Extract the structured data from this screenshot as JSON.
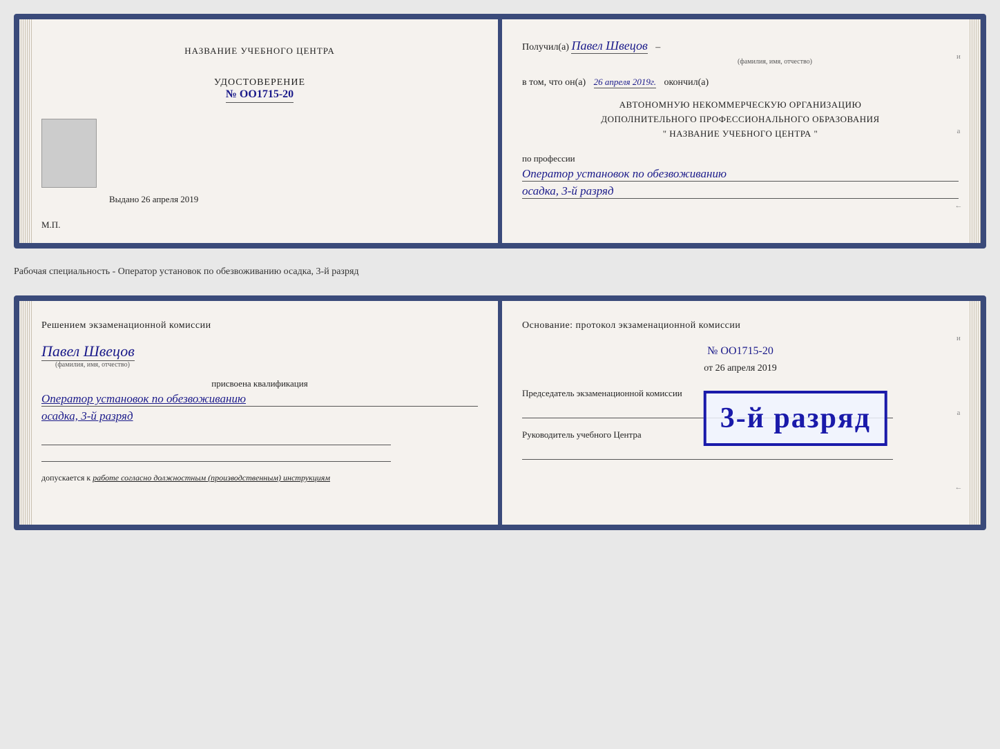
{
  "page": {
    "background_color": "#e8e8e8"
  },
  "top_document": {
    "left": {
      "title": "НАЗВАНИЕ УЧЕБНОГО ЦЕНТРА",
      "cert_label": "УДОСТОВЕРЕНИЕ",
      "cert_number": "№ OO1715-20",
      "issued_label": "Выдано",
      "issued_date": "26 апреля 2019",
      "mp_label": "М.П."
    },
    "right": {
      "received_prefix": "Получил(а)",
      "received_name": "Павел Швецов",
      "fio_label": "(фамилия, имя, отчество)",
      "dash": "–",
      "that_line_prefix": "в том, что он(а)",
      "date_value": "26 апреля 2019г.",
      "finished_label": "окончил(а)",
      "org_line1": "АВТОНОМНУЮ НЕКОММЕРЧЕСКУЮ ОРГАНИЗАЦИЮ",
      "org_line2": "ДОПОЛНИТЕЛЬНОГО ПРОФЕССИОНАЛЬНОГО ОБРАЗОВАНИЯ",
      "org_line3": "\"   НАЗВАНИЕ УЧЕБНОГО ЦЕНТРА   \"",
      "profession_label": "по профессии",
      "profession_value": "Оператор установок по обезвоживанию",
      "rank_value": "осадка, 3-й разряд"
    }
  },
  "separator": {
    "text": "Рабочая специальность - Оператор установок по обезвоживанию осадка, 3-й разряд"
  },
  "bottom_document": {
    "left": {
      "decision_title": "Решением экзаменационной комиссии",
      "person_name": "Павел Швецов",
      "fio_label": "(фамилия, имя, отчество)",
      "qualification_label": "присвоена квалификация",
      "qualification_value": "Оператор установок по обезвоживанию",
      "rank_value": "осадка, 3-й разряд",
      "допуск_prefix": "допускается к",
      "допуск_text": "работе согласно должностным (производственным) инструкциям"
    },
    "right": {
      "basis_title": "Основание: протокол экзаменационной комиссии",
      "protocol_number": "№ OO1715-20",
      "date_prefix": "от",
      "date_value": "26 апреля 2019",
      "chairman_label": "Председатель экзаменационной комиссии",
      "leader_label": "Руководитель учебного Центра"
    },
    "stamp": {
      "text": "3-й разряд"
    }
  },
  "right_marks": [
    "и",
    "а",
    "←"
  ]
}
